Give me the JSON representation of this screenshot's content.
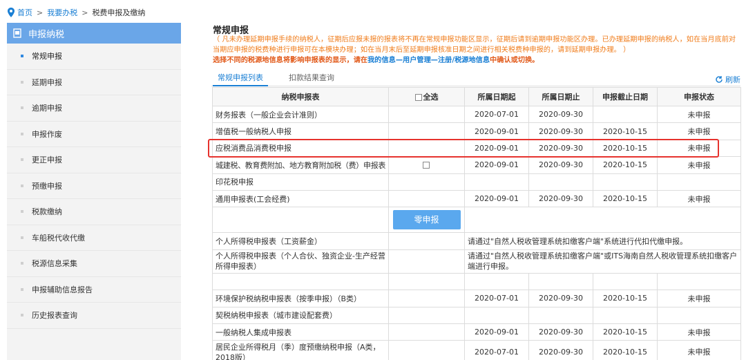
{
  "breadcrumb": {
    "home": "首页",
    "sep1": ">",
    "office": "我要办税",
    "sep2": ">",
    "current": "税费申报及缴纳"
  },
  "sidebar": {
    "header": "申报纳税",
    "items": [
      {
        "label": "常规申报",
        "active": true
      },
      {
        "label": "延期申报"
      },
      {
        "label": "逾期申报"
      },
      {
        "label": "申报作废"
      },
      {
        "label": "更正申报"
      },
      {
        "label": "预缴申报"
      },
      {
        "label": "税款缴纳"
      },
      {
        "label": "车船税代收代缴"
      },
      {
        "label": "税源信息采集"
      },
      {
        "label": "申报辅助信息报告"
      },
      {
        "label": "历史报表查询"
      }
    ]
  },
  "main": {
    "title": "常规申报",
    "notice": "（ 凡未办理延期申报手续的纳税人，征期后应报未报的报表将不再在常规申报功能区显示，征期后请到逾期申报功能区办理。已办理延期申报的纳税人，如在当月底前对当期应申报的税费种进行申报可在本模块办理；如在当月末后至延期申报核准日期之间进行相关税费种申报的，请到延期申报办理。 ）",
    "notice2_prefix": "选择不同的税源地信息将影响申报表的显示，请在",
    "notice2_link": "我的信息—用户管理—注册/税源地信息",
    "notice2_suffix": "中确认或切换。",
    "tabs": [
      "常规申报列表",
      "扣款结果查询"
    ],
    "refresh": "刷新"
  },
  "table": {
    "headers": [
      "纳税申报表",
      "全选",
      "所属日期起",
      "所属日期止",
      "申报截止日期",
      "申报状态"
    ],
    "rows": [
      {
        "name": "财务报表（一般企业会计准则）",
        "check": false,
        "start": "2020-07-01",
        "end": "2020-09-30",
        "deadline": "",
        "status": "未申报"
      },
      {
        "name": "增值税一般纳税人申报",
        "check": false,
        "start": "2020-09-01",
        "end": "2020-09-30",
        "deadline": "2020-10-15",
        "status": "未申报"
      },
      {
        "name": "应税消费品消费税申报",
        "check": false,
        "start": "2020-09-01",
        "end": "2020-09-30",
        "deadline": "2020-10-15",
        "status": "未申报"
      },
      {
        "name": "城建税、教育费附加、地方教育附加税（费）申报表",
        "check": true,
        "start": "2020-09-01",
        "end": "2020-09-30",
        "deadline": "2020-10-15",
        "status": "未申报"
      },
      {
        "name": "印花税申报",
        "check": false,
        "start": "",
        "end": "",
        "deadline": "",
        "status": ""
      },
      {
        "name": "通用申报表(工会经费)",
        "check": false,
        "start": "2020-09-01",
        "end": "2020-09-30",
        "deadline": "2020-10-15",
        "status": "未申报"
      }
    ],
    "zero_button": "零申报",
    "rows2": [
      {
        "name": "个人所得税申报表（工资薪金）",
        "note": "请通过\"自然人税收管理系统扣缴客户端\"系统进行代扣代缴申报。"
      },
      {
        "name": "个人所得税申报表（个人合伙、独资企业-生产经营所得申报表）",
        "note": "请通过\"自然人税收管理系统扣缴客户端\"或ITS海南自然人税收管理系统扣缴客户端进行申报。"
      }
    ],
    "rows3": [
      {
        "name": "",
        "start": "",
        "end": "",
        "deadline": "",
        "status": ""
      },
      {
        "name": "环境保护税纳税申报表（按季申报）（B类）",
        "start": "2020-07-01",
        "end": "2020-09-30",
        "deadline": "2020-10-15",
        "status": "未申报"
      },
      {
        "name": "契税纳税申报表（城市建设配套费）",
        "start": "",
        "end": "",
        "deadline": "",
        "status": ""
      },
      {
        "name": "一般纳税人集成申报表",
        "start": "2020-09-01",
        "end": "2020-09-30",
        "deadline": "2020-10-15",
        "status": "未申报"
      },
      {
        "name": "居民企业所得税月（季）度预缴纳税申报（A类，2018版）",
        "start": "2020-07-01",
        "end": "2020-09-30",
        "deadline": "2020-10-15",
        "status": "未申报"
      }
    ]
  },
  "colors": {
    "accent": "#1a7fd4",
    "sidebar_header": "#6aa6e8",
    "notice": "#f07d1c",
    "highlight": "#e6322d",
    "button": "#5aa8ee"
  }
}
